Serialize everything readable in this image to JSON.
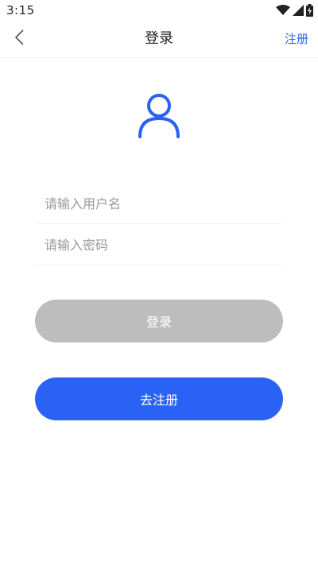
{
  "status_bar": {
    "time": "3:15",
    "icons": [
      "wifi-icon",
      "cellular-signal-icon",
      "battery-icon"
    ]
  },
  "nav": {
    "back_icon": "chevron-left-icon",
    "title": "登录",
    "register_link": "注册"
  },
  "avatar_icon": "user-icon",
  "form": {
    "username_placeholder": "请输入用户名",
    "username_value": "",
    "password_placeholder": "请输入密码",
    "password_value": ""
  },
  "buttons": {
    "login_label": "登录",
    "go_register_label": "去注册"
  },
  "colors": {
    "accent": "#2a62f6",
    "disabled_button": "#bdbdbd",
    "link": "#2a62ea"
  }
}
